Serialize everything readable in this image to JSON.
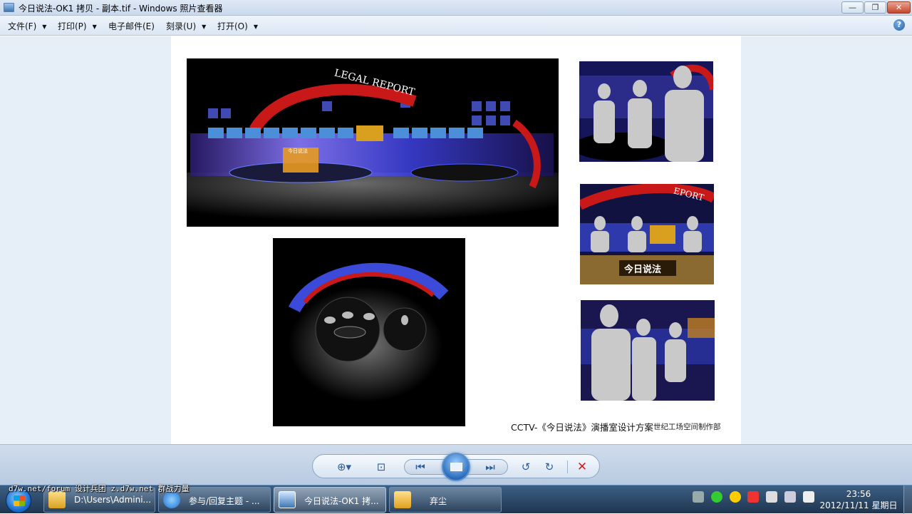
{
  "window": {
    "title": "今日说法-OK1 拷贝 - 副本.tif - Windows 照片查看器",
    "min_label": "—",
    "max_label": "❐",
    "close_label": "✕"
  },
  "menu": {
    "file": "文件(F)",
    "print": "打印(P)",
    "email": "电子邮件(E)",
    "burn": "刻录(U)",
    "open": "打开(O)",
    "help": "?"
  },
  "document": {
    "logo_text": "LEGAL REPORT",
    "logo_text_partial": "EPORT",
    "desk_text": "今日说法",
    "caption": "CCTV-《今日说法》演播室设计方案",
    "credit": "世纪工场空间制作部"
  },
  "controls": {
    "zoom": "⊕▾",
    "fit": "⊡",
    "prev": "⏮",
    "next": "⏭",
    "rotate_ccw": "↺",
    "rotate_cw": "↻",
    "delete": "✕"
  },
  "taskbar": {
    "watermark": "d7w.net/forum 设计兵团 z.d7w.net 群战力量",
    "items": [
      {
        "label": "D:\\Users\\Admini..."
      },
      {
        "label": "参与/回复主题 - ..."
      },
      {
        "label": "今日说法-OK1 拷..."
      },
      {
        "label": "弃尘"
      }
    ],
    "time": "23:56",
    "date": "2012/11/11 星期日"
  },
  "colors": {
    "accent": "#2f5e9a",
    "studio_red": "#c81818",
    "studio_blue": "#4a5cff"
  }
}
